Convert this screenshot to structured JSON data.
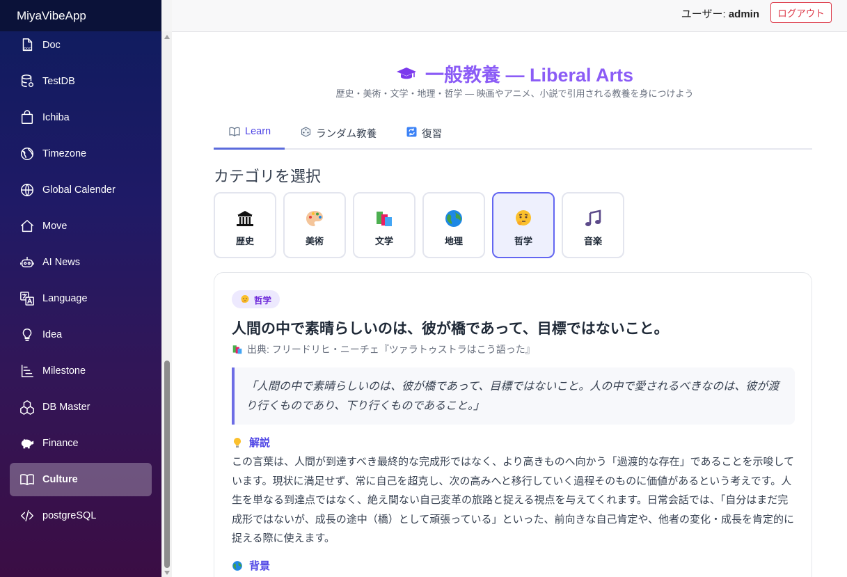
{
  "app": {
    "title": "MiyaVibeApp"
  },
  "sidebar": {
    "items": [
      {
        "label": "Doc",
        "icon": "doc-icon"
      },
      {
        "label": "TestDB",
        "icon": "database-icon"
      },
      {
        "label": "Ichiba",
        "icon": "shopping-bag-icon"
      },
      {
        "label": "Timezone",
        "icon": "globe-icon"
      },
      {
        "label": "Global Calender",
        "icon": "world-icon"
      },
      {
        "label": "Move",
        "icon": "home-icon"
      },
      {
        "label": "AI News",
        "icon": "robot-icon"
      },
      {
        "label": "Language",
        "icon": "translate-icon"
      },
      {
        "label": "Idea",
        "icon": "lightbulb-icon"
      },
      {
        "label": "Milestone",
        "icon": "milestone-icon"
      },
      {
        "label": "DB Master",
        "icon": "cubes-icon"
      },
      {
        "label": "Finance",
        "icon": "piggy-bank-icon"
      },
      {
        "label": "Culture",
        "icon": "book-icon",
        "active": true
      },
      {
        "label": "postgreSQL",
        "icon": "code-icon"
      }
    ]
  },
  "topbar": {
    "user_prefix": "ユーザー: ",
    "user_name": "admin",
    "logout_label": "ログアウト"
  },
  "page": {
    "title": "一般教養 — Liberal Arts",
    "subtitle": "歴史・美術・文学・地理・哲学 — 映画やアニメ、小説で引用される教養を身につけよう",
    "accent_color": "#8b5cf6"
  },
  "tabs": [
    {
      "label": "Learn",
      "icon": "book-icon",
      "active": true
    },
    {
      "label": "ランダム教養",
      "icon": "dice-icon"
    },
    {
      "label": "復習",
      "icon": "refresh-icon"
    }
  ],
  "categories": {
    "heading": "カテゴリを選択",
    "items": [
      {
        "label": "歴史",
        "icon": "classical-building-icon"
      },
      {
        "label": "美術",
        "icon": "palette-icon"
      },
      {
        "label": "文学",
        "icon": "books-icon"
      },
      {
        "label": "地理",
        "icon": "globe-icon"
      },
      {
        "label": "哲学",
        "icon": "thinking-face-icon",
        "active": true
      },
      {
        "label": "音楽",
        "icon": "music-note-icon"
      }
    ]
  },
  "card": {
    "badge": "哲学",
    "title": "人間の中で素晴らしいのは、彼が橋であって、目標ではないこと。",
    "source": "出典: フリードリヒ・ニーチェ『ツァラトゥストラはこう語った』",
    "quote": "「人間の中で素晴らしいのは、彼が橋であって、目標ではないこと。人の中で愛されるべきなのは、彼が渡り行くものであり、下り行くものであること。」",
    "explain_heading": "解説",
    "explain_text": "この言葉は、人間が到達すべき最終的な完成形ではなく、より高きものへ向かう「過渡的な存在」であることを示唆しています。現状に満足せず、常に自己を超克し、次の高みへと移行していく過程そのものに価値があるという考えです。人生を単なる到達点ではなく、絶え間ない自己変革の旅路と捉える視点を与えてくれます。日常会話では、「自分はまだ完成形ではないが、成長の途中（橋）として頑張っている」といった、前向きな自己肯定や、他者の変化・成長を肯定的に捉える際に使えます。",
    "background_heading": "背景"
  }
}
